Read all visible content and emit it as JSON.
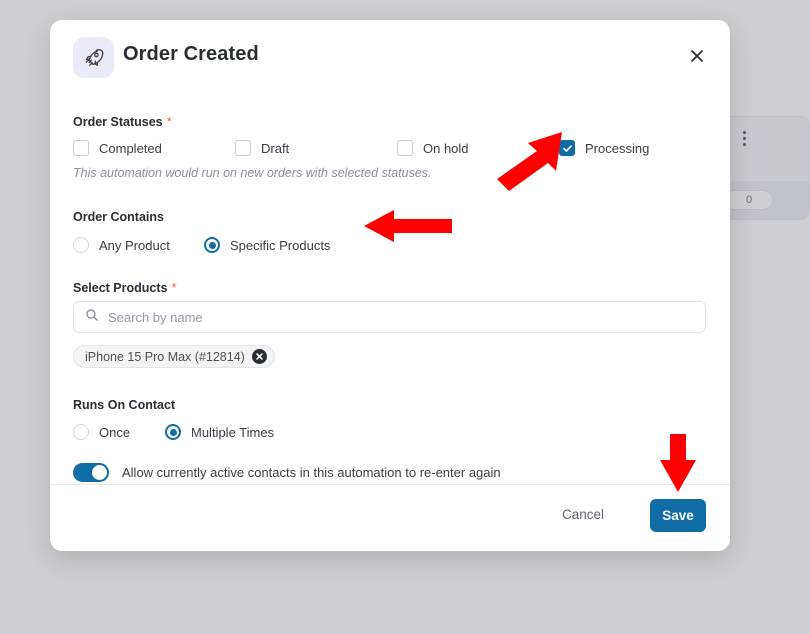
{
  "background": {
    "card": {
      "menu_icon": "kebab-menu-icon",
      "badge_count": "0"
    }
  },
  "modal": {
    "icon": "rocket-icon",
    "title": "Order Created",
    "close_icon": "close-icon",
    "sections": {
      "order_statuses": {
        "label": "Order Statuses",
        "required_marker": "*",
        "helper_text": "This automation would run on new orders with selected statuses.",
        "options": [
          {
            "label": "Completed",
            "checked": false
          },
          {
            "label": "Draft",
            "checked": false
          },
          {
            "label": "On hold",
            "checked": false
          },
          {
            "label": "Processing",
            "checked": true
          }
        ]
      },
      "order_contains": {
        "label": "Order Contains",
        "options": [
          {
            "label": "Any Product",
            "selected": false
          },
          {
            "label": "Specific Products",
            "selected": true
          }
        ]
      },
      "select_products": {
        "label": "Select Products",
        "required_marker": "*",
        "search_placeholder": "Search by name",
        "search_value": "",
        "search_icon": "search-icon",
        "chips": [
          {
            "label": "iPhone 15 Pro Max (#12814)",
            "remove_icon": "close-circle-icon"
          }
        ]
      },
      "runs_on_contact": {
        "label": "Runs On Contact",
        "options": [
          {
            "label": "Once",
            "selected": false
          },
          {
            "label": "Multiple Times",
            "selected": true
          }
        ],
        "toggle": {
          "label": "Allow currently active contacts in this automation to re-enter again",
          "on": true
        }
      }
    },
    "footer": {
      "cancel_label": "Cancel",
      "save_label": "Save"
    }
  },
  "annotations": {
    "arrows": [
      {
        "name": "arrow-to-processing-checkbox",
        "direction": "up-right"
      },
      {
        "name": "arrow-to-specific-products-radio",
        "direction": "left"
      },
      {
        "name": "arrow-to-save-button",
        "direction": "down"
      }
    ],
    "color": "#ff0000"
  },
  "colors": {
    "accent": "#0f6ca4",
    "arrow_red": "#ff0000",
    "required_star": "#e8604c",
    "modal_background": "#ffffff",
    "overlay": "#8c8c94"
  }
}
